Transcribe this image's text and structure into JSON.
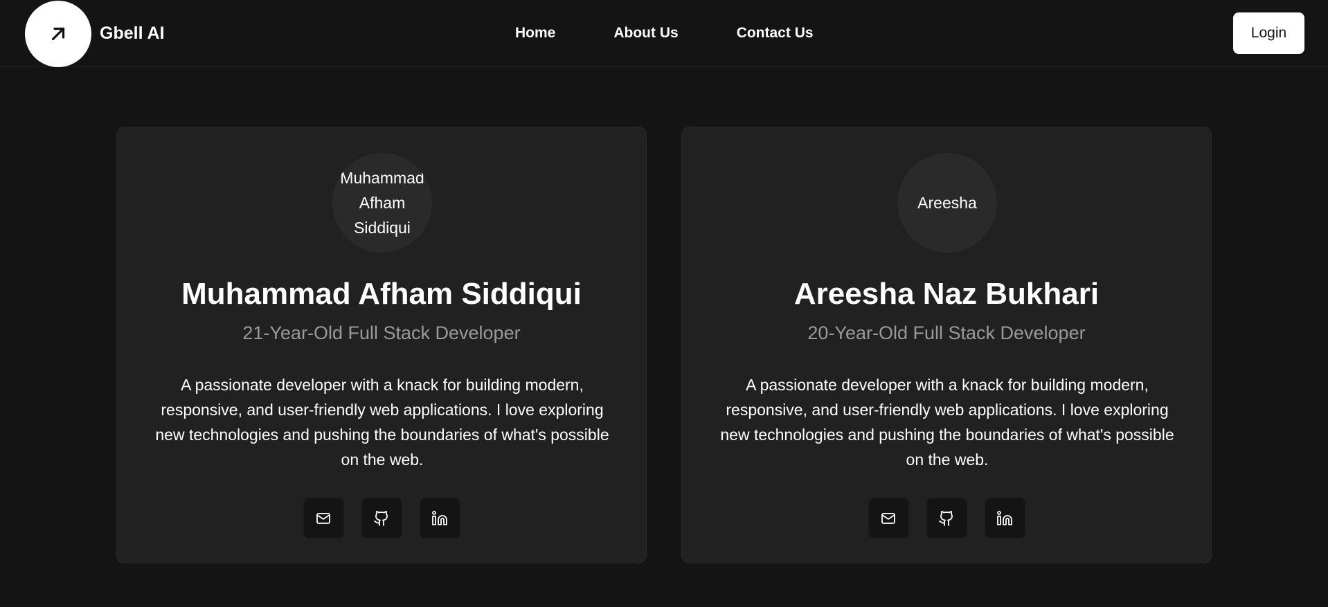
{
  "header": {
    "brand": "Gbell AI",
    "logo_icon": "arrow-up-right-icon",
    "nav": [
      {
        "label": "Home"
      },
      {
        "label": "About Us"
      },
      {
        "label": "Contact Us"
      }
    ],
    "login_label": "Login"
  },
  "team": [
    {
      "avatar_alt": "Muhammad Afham Siddiqui",
      "name": "Muhammad Afham Siddiqui",
      "role": "21-Year-Old Full Stack Developer",
      "bio": "A passionate developer with a knack for building modern, responsive, and user-friendly web applications. I love exploring new technologies and pushing the boundaries of what's possible on the web.",
      "socials": [
        "mail-icon",
        "github-icon",
        "linkedin-icon"
      ]
    },
    {
      "avatar_alt": "Areesha",
      "name": "Areesha Naz Bukhari",
      "role": "20-Year-Old Full Stack Developer",
      "bio": "A passionate developer with a knack for building modern, responsive, and user-friendly web applications. I love exploring new technologies and pushing the boundaries of what's possible on the web.",
      "socials": [
        "mail-icon",
        "github-icon",
        "linkedin-icon"
      ]
    }
  ],
  "colors": {
    "background": "#141414",
    "card": "#212121",
    "muted_text": "#9a9a9a",
    "accent": "#ffffff"
  }
}
